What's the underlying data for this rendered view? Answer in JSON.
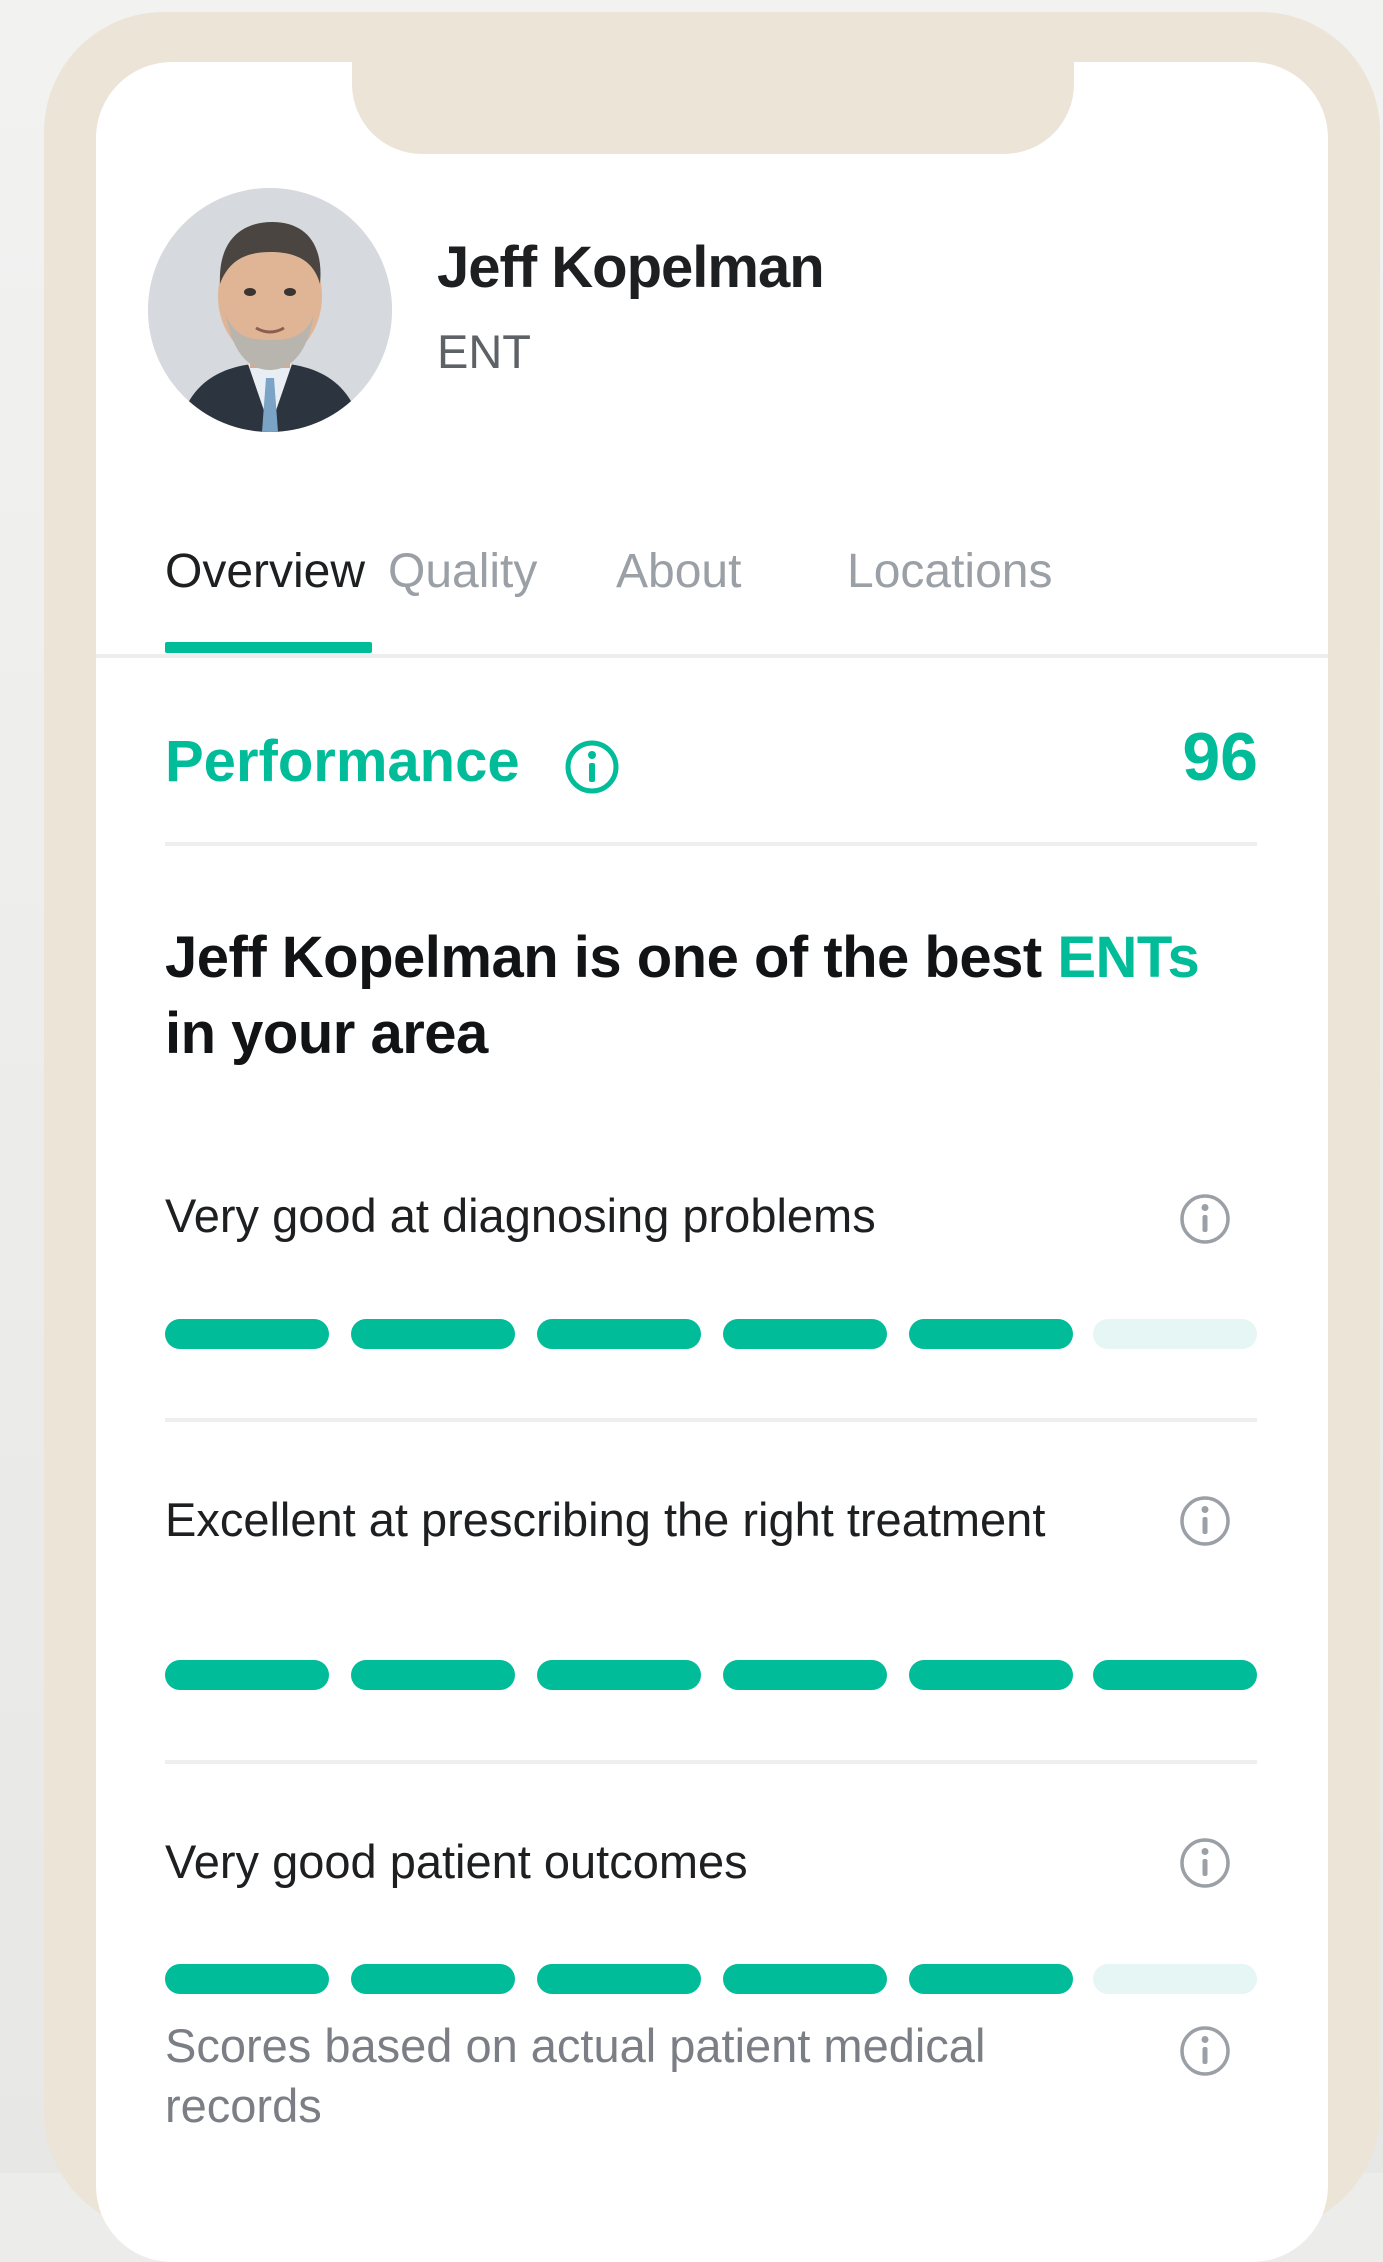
{
  "profile": {
    "name": "Jeff Kopelman",
    "specialty": "ENT"
  },
  "tabs": [
    {
      "label": "Overview",
      "active": true
    },
    {
      "label": "Quality",
      "active": false
    },
    {
      "label": "About",
      "active": false
    },
    {
      "label": "Locations",
      "active": false
    }
  ],
  "performance": {
    "title": "Performance",
    "score": "96",
    "headline_prefix": "Jeff Kopelman is one of the best ",
    "headline_accent": "ENTs",
    "headline_suffix": " in your area"
  },
  "metrics": [
    {
      "label": "Very good at diagnosing problems",
      "filled": 5,
      "total": 6
    },
    {
      "label": "Excellent at prescribing the right treatment",
      "filled": 6,
      "total": 6
    },
    {
      "label": "Very good patient outcomes",
      "filled": 5,
      "total": 6
    }
  ],
  "footnote": "Scores based on actual patient medical records",
  "colors": {
    "accent": "#00bc99",
    "accent_light": "#e6f6f4",
    "frame": "#ebe4d7"
  }
}
